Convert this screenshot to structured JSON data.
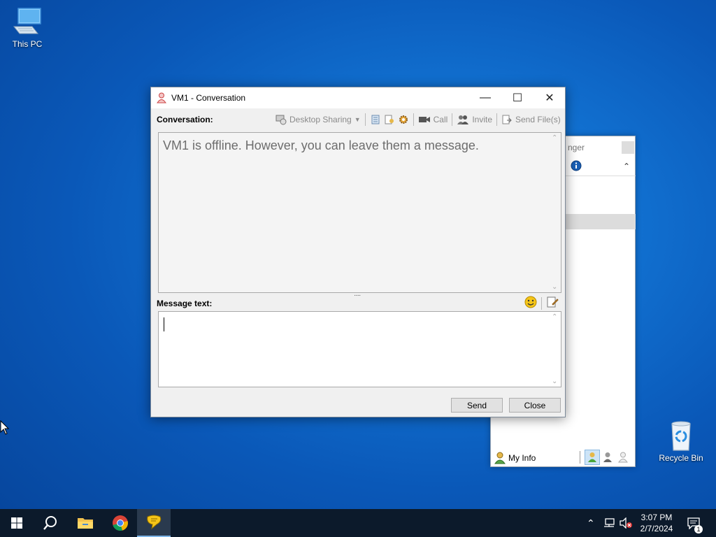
{
  "desktop": {
    "icons": [
      {
        "label": "This PC"
      },
      {
        "label": "Recycle Bin"
      }
    ]
  },
  "messenger": {
    "title_fragment": "nger",
    "footer_my_info": "My Info"
  },
  "conversation": {
    "title": "VM1 - Conversation",
    "conversation_label": "Conversation:",
    "toolbar": {
      "desktop_sharing": "Desktop Sharing",
      "call": "Call",
      "invite": "Invite",
      "send_files": "Send File(s)"
    },
    "offline_notice": "VM1 is offline. However, you can leave them a message.",
    "message_label": "Message text:",
    "message_value": "",
    "send_label": "Send",
    "close_label": "Close"
  },
  "taskbar": {
    "time": "3:07 PM",
    "date": "2/7/2024",
    "notification_count": "1"
  },
  "colors": {
    "desktop_blue": "#0a58b8",
    "taskbar": "#0c1a2b",
    "window_bg": "#f0f0f0"
  },
  "icons": [
    "pc-icon",
    "recycle-bin-icon",
    "user-icon",
    "info-icon",
    "desktop-sharing-icon",
    "history-icon",
    "file-icon",
    "settings-icon",
    "video-icon",
    "invite-icon",
    "send-file-icon",
    "smiley-icon",
    "edit-icon",
    "start-icon",
    "search-icon",
    "folder-icon",
    "chrome-icon",
    "messenger-icon",
    "network-icon",
    "volume-muted-icon",
    "notification-icon"
  ]
}
